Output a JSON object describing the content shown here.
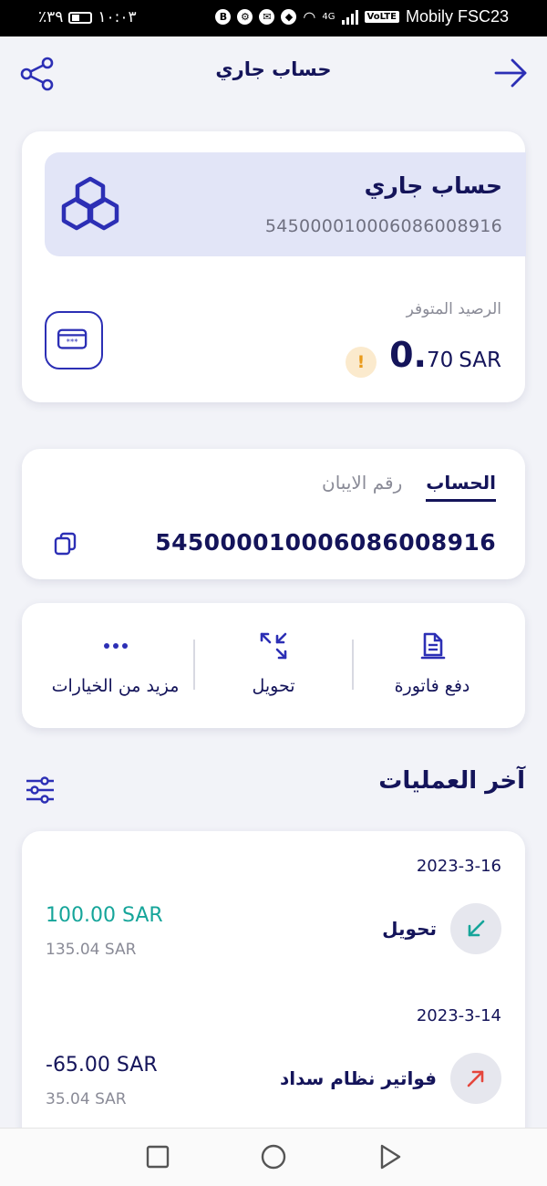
{
  "status_bar": {
    "time": "١٠:٠٣",
    "battery": "٣٩٪",
    "network": "4G",
    "carrier": "Mobily FSC23",
    "volte": "VoLTE"
  },
  "header": {
    "title": "حساب جاري"
  },
  "account": {
    "name": "حساب جاري",
    "number": "545000010006086008916",
    "balance_label": "الرصيد المتوفر",
    "balance_integer": "0.",
    "balance_decimal": "70",
    "currency": "SAR"
  },
  "iban_card": {
    "tabs": [
      {
        "label": "الحساب",
        "active": true
      },
      {
        "label": "رقم الايبان",
        "active": false
      }
    ],
    "value": "545000010006086008916"
  },
  "actions": [
    {
      "label": "دفع فاتورة",
      "icon": "bill-icon"
    },
    {
      "label": "تحويل",
      "icon": "transfer-icon"
    },
    {
      "label": "مزيد من الخيارات",
      "icon": "more-icon"
    }
  ],
  "recent": {
    "title": "آخر العمليات",
    "transactions": [
      {
        "date": "2023-3-16",
        "name": "تحويل",
        "amount": "100.00 SAR",
        "balance_after": "135.04 SAR",
        "direction": "in",
        "color": "#16a59a"
      },
      {
        "date": "2023-3-14",
        "name": "فواتير نظام سداد",
        "amount": "-65.00 SAR",
        "balance_after": "35.04 SAR",
        "direction": "out",
        "color": "#e5463c"
      }
    ]
  },
  "colors": {
    "primary": "#14145a",
    "accent": "#2c2fb5",
    "positive": "#16a59a",
    "warning": "#e99a1b",
    "background": "#f2f3f8"
  }
}
